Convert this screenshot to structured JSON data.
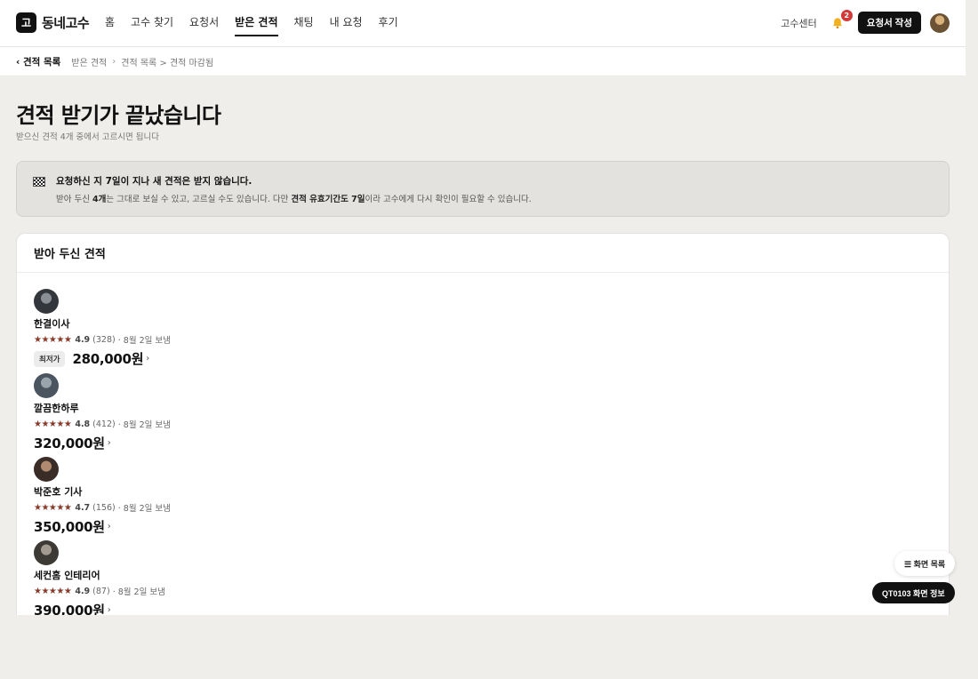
{
  "header": {
    "logo_mark": "고",
    "logo_text": "동네고수",
    "nav": [
      "홈",
      "고수 찾기",
      "요청서",
      "받은 견적",
      "채팅",
      "내 요청",
      "후기"
    ],
    "pro_center": "고수센터",
    "notification_count": "2",
    "write_button": "요청서 작성"
  },
  "breadcrumb": {
    "back": "‹ 견적 목록",
    "items": [
      "받은 견적",
      "견적 목록 > 견적 마감됨"
    ],
    "separator": "›"
  },
  "page": {
    "title": "견적 받기가 끝났습니다",
    "subtitle": "받으신 견적 4개 중에서 고르시면 됩니다"
  },
  "notice": {
    "title": "요청하신 지 7일이 지나 새 견적은 받지 않습니다.",
    "body_1": "받아 두신 ",
    "body_bold_1": "4개",
    "body_2": "는 그대로 보실 수 있고, 고르실 수도 있습니다. 다만 ",
    "body_bold_2": "견적 유효기간도 7일",
    "body_3": "이라 고수에게 다시 확인이 필요할 수 있습니다."
  },
  "card": {
    "title": "받아 두신 견적",
    "lowest_label": "최저가",
    "stars": "★★★★★",
    "chevron": "›",
    "quotes": [
      {
        "name": "한결이사",
        "rating": "4.9",
        "reviews": "(328)",
        "sent": "· 8월 2일 보냄",
        "price": "280,000원"
      },
      {
        "name": "깔끔한하루",
        "rating": "4.8",
        "reviews": "(412)",
        "sent": "· 8월 2일 보냄",
        "price": "320,000원"
      },
      {
        "name": "박준호 기사",
        "rating": "4.7",
        "reviews": "(156)",
        "sent": "· 8월 2일 보냄",
        "price": "350,000원"
      },
      {
        "name": "세컨홈 인테리어",
        "rating": "4.9",
        "reviews": "(87)",
        "sent": "· 8월 2일 보냄",
        "price": "390,000원"
      }
    ]
  },
  "floating": {
    "screen_list": "☰ 화면 목록",
    "screen_info": "QT0103 화면 정보"
  }
}
